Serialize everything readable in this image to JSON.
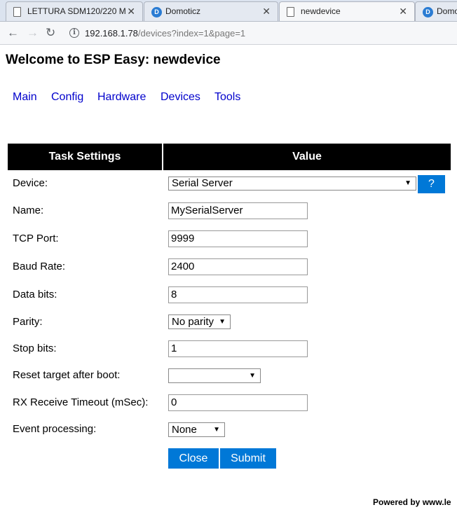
{
  "browser": {
    "tabs": [
      {
        "title": "LETTURA SDM120/220 M",
        "icon": "document-icon"
      },
      {
        "title": "Domoticz",
        "icon": "domoticz-icon"
      },
      {
        "title": "newdevice",
        "icon": "document-icon"
      },
      {
        "title": "Domo",
        "icon": "domoticz-icon"
      }
    ],
    "close_glyph": "✕",
    "url_host": "192.168.1.78",
    "url_path": "/devices?index=1&page=1"
  },
  "page": {
    "title": "Welcome to ESP Easy: newdevice",
    "menu": [
      "Main",
      "Config",
      "Hardware",
      "Devices",
      "Tools"
    ]
  },
  "table": {
    "col1": "Task Settings",
    "col2": "Value"
  },
  "form": {
    "device": {
      "label": "Device:",
      "value": "Serial Server",
      "help": "?"
    },
    "name": {
      "label": "Name:",
      "value": "MySerialServer"
    },
    "tcp_port": {
      "label": "TCP Port:",
      "value": "9999"
    },
    "baud_rate": {
      "label": "Baud Rate:",
      "value": "2400"
    },
    "data_bits": {
      "label": "Data bits:",
      "value": "8"
    },
    "parity": {
      "label": "Parity:",
      "value": "No parity"
    },
    "stop_bits": {
      "label": "Stop bits:",
      "value": "1"
    },
    "reset_target": {
      "label": "Reset target after boot:",
      "value": ""
    },
    "rx_timeout": {
      "label": "RX Receive Timeout (mSec):",
      "value": "0"
    },
    "event_processing": {
      "label": "Event processing:",
      "value": "None"
    }
  },
  "buttons": {
    "close": "Close",
    "submit": "Submit"
  },
  "footer": "Powered by www.le",
  "colors": {
    "accent": "#0078d7",
    "link": "#0000cc",
    "header_bg": "#000000"
  }
}
